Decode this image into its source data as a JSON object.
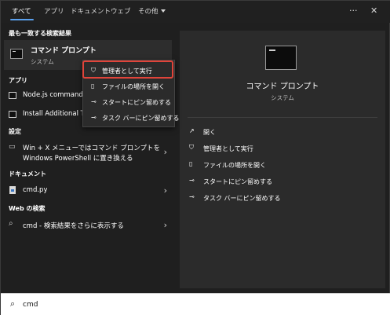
{
  "tabs": [
    {
      "label": "すべて"
    },
    {
      "label": "アプリ"
    },
    {
      "label": "ドキュメント"
    },
    {
      "label": "ウェブ"
    },
    {
      "label": "その他"
    }
  ],
  "top_icons": {
    "more": "···",
    "close": "✕"
  },
  "sections": {
    "best_match": "最も一致する検索結果",
    "apps": "アプリ",
    "settings": "設定",
    "documents": "ドキュメント",
    "web": "Web の検索"
  },
  "best_match": {
    "title": "コマンド プロンプト",
    "subtitle": "システム"
  },
  "apps": [
    {
      "label": "Node.js command prompt"
    },
    {
      "label": "Install Additional Tools for Node.js"
    }
  ],
  "settings": [
    {
      "line1": "Win + X メニューではコマンド プロンプトを",
      "line2": "Windows PowerShell に置き換える"
    }
  ],
  "documents": [
    {
      "label": "cmd.py"
    }
  ],
  "web": [
    {
      "label": "cmd - 検索結果をさらに表示する"
    }
  ],
  "context_menu": [
    {
      "label": "管理者として実行",
      "icon": "shield-icon"
    },
    {
      "label": "ファイルの場所を開く",
      "icon": "file-location-icon"
    },
    {
      "label": "スタートにピン留めする",
      "icon": "pin-icon"
    },
    {
      "label": "タスク バーにピン留めする",
      "icon": "pin-icon"
    }
  ],
  "detail": {
    "title": "コマンド プロンプト",
    "subtitle": "システム",
    "actions": [
      {
        "label": "開く",
        "icon": "open-icon"
      },
      {
        "label": "管理者として実行",
        "icon": "shield-icon"
      },
      {
        "label": "ファイルの場所を開く",
        "icon": "file-location-icon"
      },
      {
        "label": "スタートにピン留めする",
        "icon": "pin-icon"
      },
      {
        "label": "タスク バーにピン留めする",
        "icon": "pin-icon"
      }
    ]
  },
  "search": {
    "value": "cmd"
  },
  "colors": {
    "accent": "#5aa0ee",
    "highlight": "#e0443a",
    "panel": "#2b2b2b",
    "background": "#1f1f1f"
  }
}
